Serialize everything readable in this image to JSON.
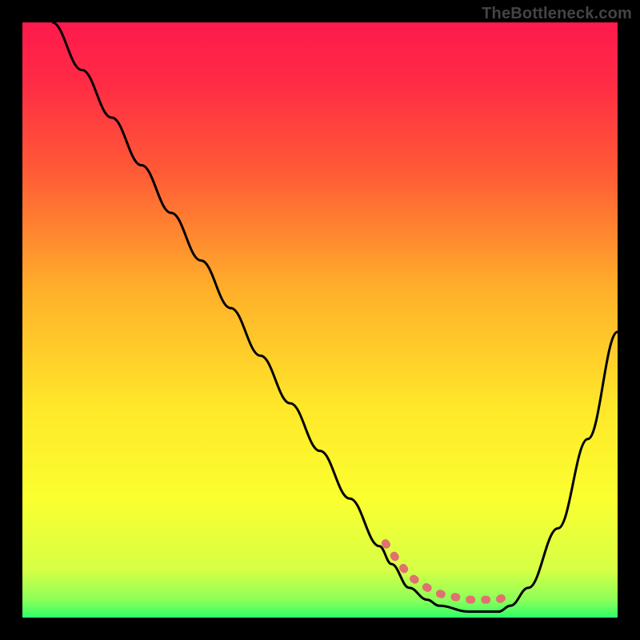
{
  "watermark": "TheBottleneck.com",
  "colors": {
    "gradient_stops": [
      {
        "offset": 0.0,
        "color": "#ff1a4d"
      },
      {
        "offset": 0.1,
        "color": "#ff2b45"
      },
      {
        "offset": 0.25,
        "color": "#ff5a36"
      },
      {
        "offset": 0.45,
        "color": "#ffb02a"
      },
      {
        "offset": 0.65,
        "color": "#ffe82a"
      },
      {
        "offset": 0.8,
        "color": "#fbff2f"
      },
      {
        "offset": 0.92,
        "color": "#d6ff45"
      },
      {
        "offset": 0.97,
        "color": "#8dff58"
      },
      {
        "offset": 1.0,
        "color": "#2eff6a"
      }
    ],
    "curve": "#000000",
    "marker": "#e17070",
    "background": "#000000"
  },
  "chart_data": {
    "type": "line",
    "title": "",
    "xlabel": "",
    "ylabel": "",
    "xlim": [
      0,
      100
    ],
    "ylim": [
      0,
      100
    ],
    "grid": false,
    "legend": false,
    "series": [
      {
        "name": "bottleneck-curve",
        "x": [
          5,
          10,
          15,
          20,
          25,
          30,
          35,
          40,
          45,
          50,
          55,
          60,
          62,
          65,
          68,
          70,
          75,
          80,
          82,
          85,
          90,
          95,
          100
        ],
        "values": [
          100,
          92,
          84,
          76,
          68,
          60,
          52,
          44,
          36,
          28,
          20,
          12,
          9,
          5,
          3,
          2,
          1,
          1,
          2,
          5,
          15,
          30,
          48
        ]
      }
    ],
    "annotations": [
      {
        "name": "optimal-band-markers",
        "x_start": 61,
        "x_end": 82,
        "y_approx": 3
      }
    ]
  }
}
